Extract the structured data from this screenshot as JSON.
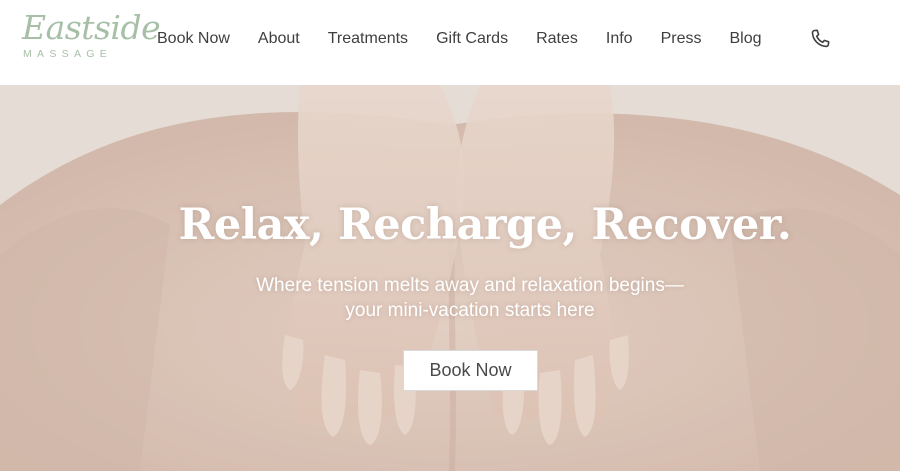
{
  "brand": {
    "logo_script": "Eastside",
    "logo_sub": "MASSAGE",
    "logo_color": "#a7bfa7"
  },
  "nav": {
    "items": [
      {
        "label": "Book Now"
      },
      {
        "label": "About"
      },
      {
        "label": "Treatments"
      },
      {
        "label": "Gift Cards"
      },
      {
        "label": "Rates"
      },
      {
        "label": "Info"
      },
      {
        "label": "Press"
      },
      {
        "label": "Blog"
      }
    ],
    "phone_icon": "phone-icon"
  },
  "hero": {
    "title": "Relax, Recharge, Recover.",
    "subtitle_line1": "Where tension melts away and relaxation begins—",
    "subtitle_line2": "your mini-vacation starts here",
    "button_label": "Book Now",
    "image": "massage-hands-on-back"
  },
  "colors": {
    "text": "#3f3f3f",
    "hero_text": "#ffffff",
    "skin": "#e3cfc2"
  }
}
